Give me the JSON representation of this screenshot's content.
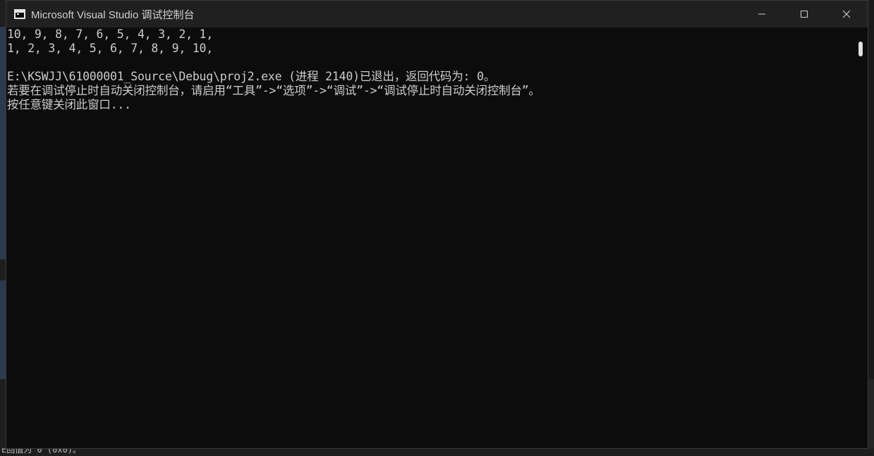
{
  "window": {
    "title": "Microsoft Visual Studio 调试控制台",
    "controls": {
      "minimize": "minimize-icon",
      "maximize": "maximize-icon",
      "close": "close-icon"
    }
  },
  "console": {
    "lines": [
      "10, 9, 8, 7, 6, 5, 4, 3, 2, 1,",
      "1, 2, 3, 4, 5, 6, 7, 8, 9, 10,",
      "",
      "E:\\KSWJJ\\61000001_Source\\Debug\\proj2.exe (进程 2140)已退出，返回代码为: 0。",
      "若要在调试停止时自动关闭控制台，请启用“工具”->“选项”->“调试”->“调试停止时自动关闭控制台”。",
      "按任意键关闭此窗口..."
    ]
  },
  "background": {
    "bottom_text": "E回值为 0 (0x0)。"
  },
  "colors": {
    "console_bg": "#0c0c0c",
    "console_text": "#cccccc",
    "titlebar_bg": "#202020"
  }
}
